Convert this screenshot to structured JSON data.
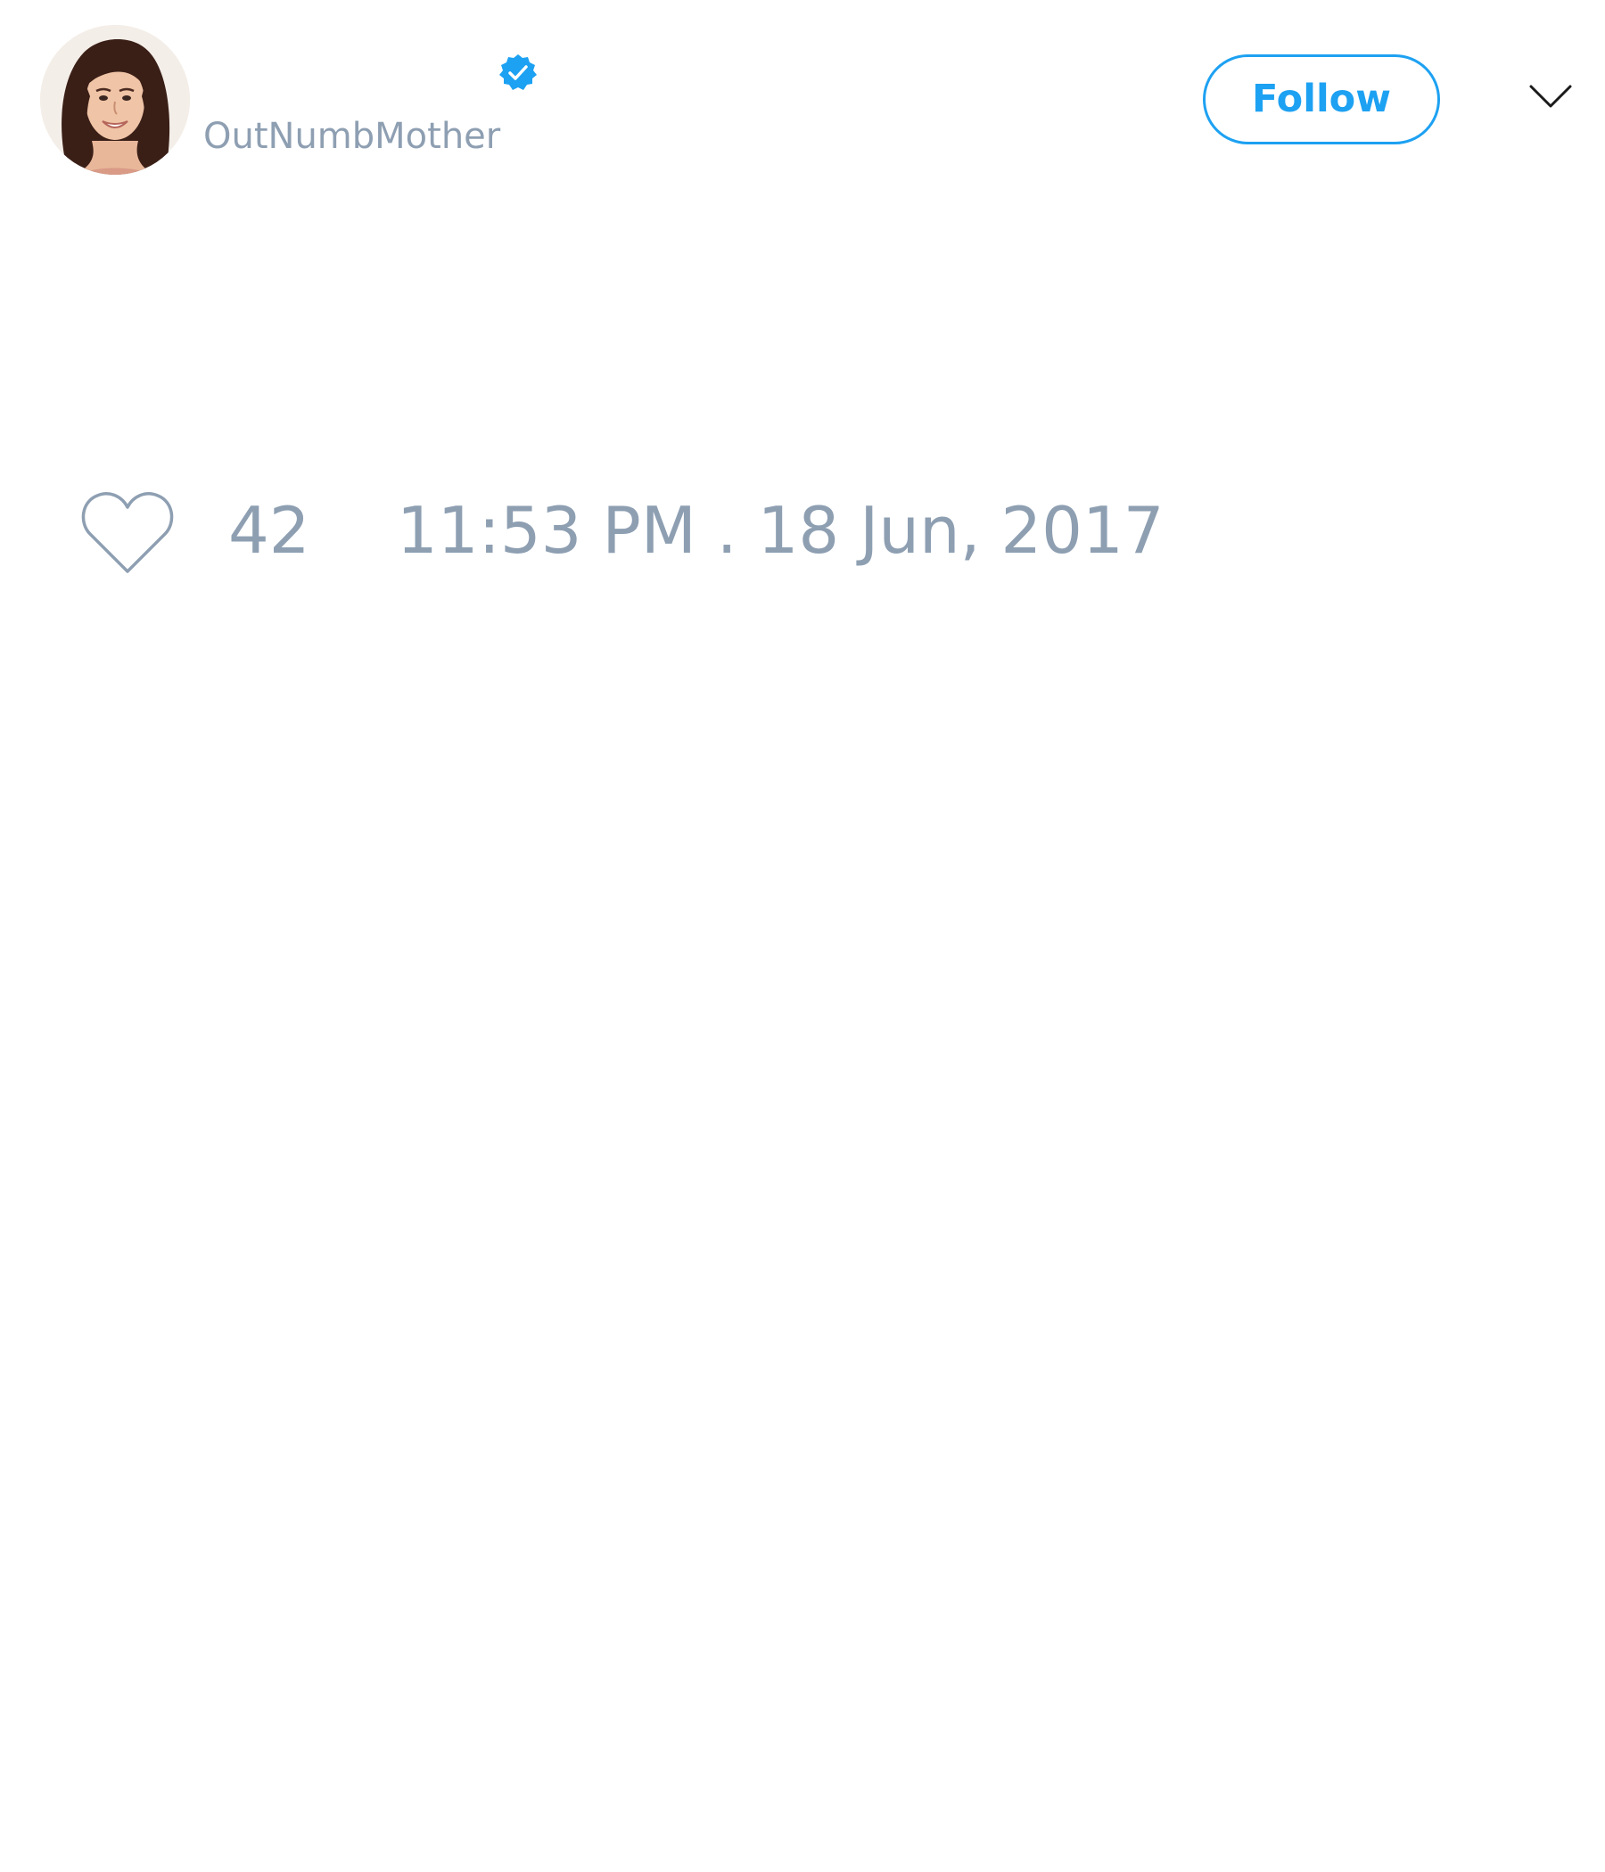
{
  "tweet": {
    "author": {
      "handle": "OutNumbMother",
      "avatar_icon": "profile-photo",
      "verified": true,
      "verified_icon": "verified-badge-icon"
    },
    "follow_label": "Follow",
    "menu_icon": "chevron-down-icon",
    "likes": {
      "icon": "heart-icon",
      "count": "42"
    },
    "timestamp": "11:53 PM . 18 Jun, 2017"
  },
  "colors": {
    "accent": "#1da1f2",
    "muted_text": "#8e9fb2",
    "background": "#ffffff"
  }
}
